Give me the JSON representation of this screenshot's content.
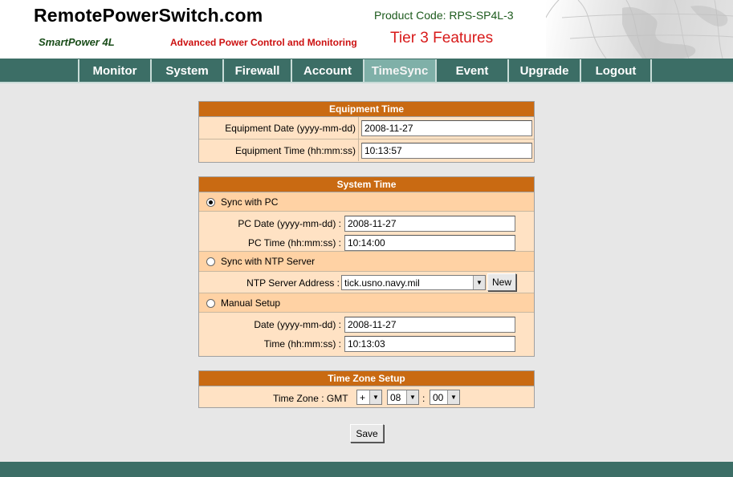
{
  "header": {
    "brand": "RemotePowerSwitch.com",
    "model": "SmartPower 4L",
    "tagline": "Advanced Power Control and Monitoring",
    "product_code": "Product Code: RPS-SP4L-3",
    "tier": "Tier 3 Features"
  },
  "nav": {
    "items": [
      "Monitor",
      "System",
      "Firewall",
      "Account",
      "TimeSync",
      "Event",
      "Upgrade",
      "Logout"
    ],
    "active": "TimeSync"
  },
  "equipment_time": {
    "title": "Equipment Time",
    "date_label": "Equipment Date (yyyy-mm-dd)",
    "date_value": "2008-11-27",
    "time_label": "Equipment Time (hh:mm:ss)",
    "time_value": "10:13:57"
  },
  "system_time": {
    "title": "System Time",
    "sync_pc_label": "Sync with PC",
    "pc_date_label": "PC Date (yyyy-mm-dd) :",
    "pc_date_value": "2008-11-27",
    "pc_time_label": "PC Time (hh:mm:ss) :",
    "pc_time_value": "10:14:00",
    "sync_ntp_label": "Sync with NTP Server",
    "ntp_label": "NTP Server Address :",
    "ntp_value": "tick.usno.navy.mil",
    "new_label": "New",
    "manual_label": "Manual Setup",
    "manual_date_label": "Date (yyyy-mm-dd) :",
    "manual_date_value": "2008-11-27",
    "manual_time_label": "Time (hh:mm:ss) :",
    "manual_time_value": "10:13:03",
    "selected_mode": "Sync with PC"
  },
  "timezone": {
    "title": "Time Zone Setup",
    "label": "Time Zone : GMT",
    "sign": "+",
    "hours": "08",
    "colon": ":",
    "minutes": "00"
  },
  "save_label": "Save",
  "colors": {
    "nav_bg": "#3c6e66",
    "nav_active": "#7fb0a8",
    "panel_header": "#c96a12",
    "panel_bg": "#ffe2c4",
    "radio_row_bg": "#ffd2a4"
  }
}
